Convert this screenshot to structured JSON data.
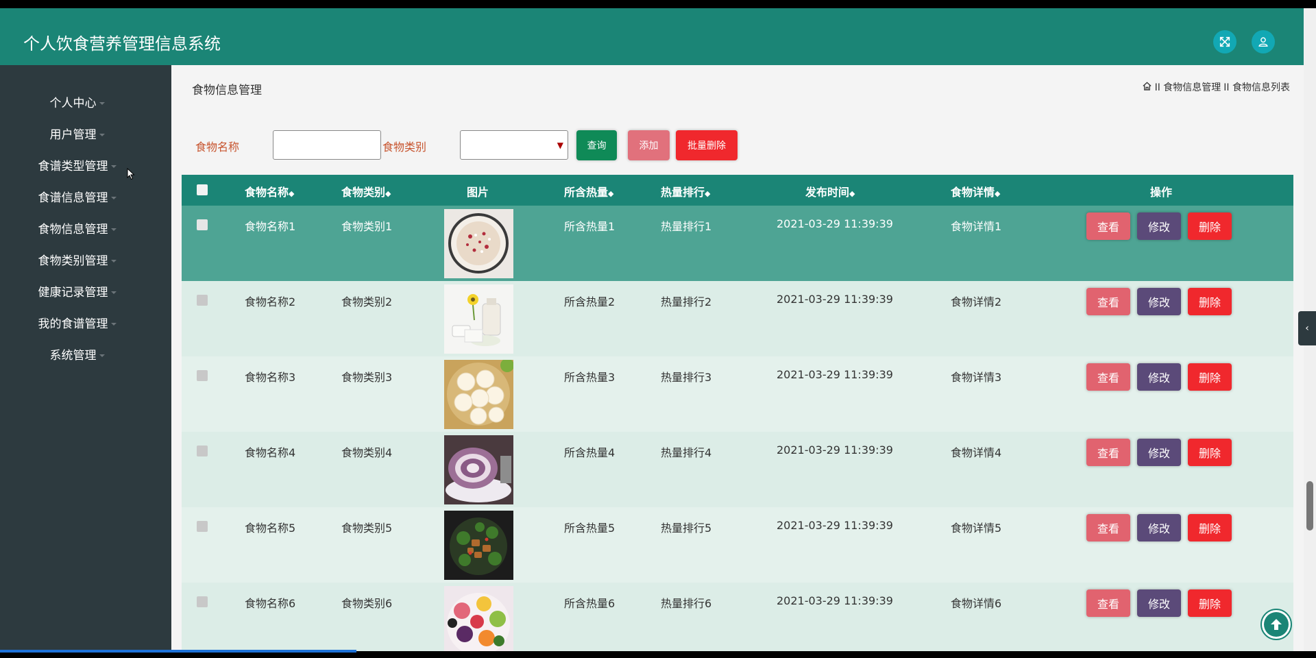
{
  "app": {
    "title": "个人饮食营养管理信息系统"
  },
  "sidebar": {
    "items": [
      {
        "label": "个人中心"
      },
      {
        "label": "用户管理"
      },
      {
        "label": "食谱类型管理"
      },
      {
        "label": "食谱信息管理"
      },
      {
        "label": "食物信息管理"
      },
      {
        "label": "食物类别管理"
      },
      {
        "label": "健康记录管理"
      },
      {
        "label": "我的食谱管理"
      },
      {
        "label": "系统管理"
      }
    ]
  },
  "page": {
    "title": "食物信息管理",
    "breadcrumb": [
      "II 食物信息管理",
      "II 食物信息列表"
    ]
  },
  "search": {
    "name_label": "食物名称",
    "name_value": "",
    "category_label": "食物类别",
    "category_value": "",
    "query_label": "查询",
    "add_label": "添加",
    "batch_delete_label": "批量删除"
  },
  "table": {
    "headers": {
      "name": "食物名称",
      "category": "食物类别",
      "image": "图片",
      "calories": "所含热量",
      "rank": "热量排行",
      "publish_time": "发布时间",
      "details": "食物详情",
      "actions": "操作"
    },
    "action_labels": {
      "view": "查看",
      "edit": "修改",
      "delete": "删除"
    },
    "rows": [
      {
        "name": "食物名称1",
        "category": "食物类别1",
        "calories": "所含热量1",
        "rank": "热量排行1",
        "publish_time": "2021-03-29 11:39:39",
        "details": "食物详情1",
        "image": "rice-porridge"
      },
      {
        "name": "食物名称2",
        "category": "食物类别2",
        "calories": "所含热量2",
        "rank": "热量排行2",
        "publish_time": "2021-03-29 11:39:39",
        "details": "食物详情2",
        "image": "milk-cheese"
      },
      {
        "name": "食物名称3",
        "category": "食物类别3",
        "calories": "所含热量3",
        "rank": "热量排行3",
        "publish_time": "2021-03-29 11:39:39",
        "details": "食物详情3",
        "image": "steamed-buns"
      },
      {
        "name": "食物名称4",
        "category": "食物类别4",
        "calories": "所含热量4",
        "rank": "热量排行4",
        "publish_time": "2021-03-29 11:39:39",
        "details": "食物详情4",
        "image": "purple-swirl-buns"
      },
      {
        "name": "食物名称5",
        "category": "食物类别5",
        "calories": "所含热量5",
        "rank": "热量排行5",
        "publish_time": "2021-03-29 11:39:39",
        "details": "食物详情5",
        "image": "broccoli-stir-fry"
      },
      {
        "name": "食物名称6",
        "category": "食物类别6",
        "calories": "所含热量6",
        "rank": "热量排行6",
        "publish_time": "2021-03-29 11:39:39",
        "details": "食物详情6",
        "image": "fruit-platter"
      }
    ]
  },
  "icons": {
    "fullscreen": "fullscreen-icon",
    "user": "user-icon",
    "home": "home-icon",
    "back_to_top": "arrow-up-icon",
    "collapse_tab": "chevron-left-icon"
  },
  "colors": {
    "primary": "#1b8576",
    "sidebar": "#2d3a3f",
    "selected_row": "#4ea494",
    "view_button": "#e1636f",
    "edit_button": "#5b4a79",
    "delete_button": "#f0282d",
    "label_text": "#c7542e"
  }
}
